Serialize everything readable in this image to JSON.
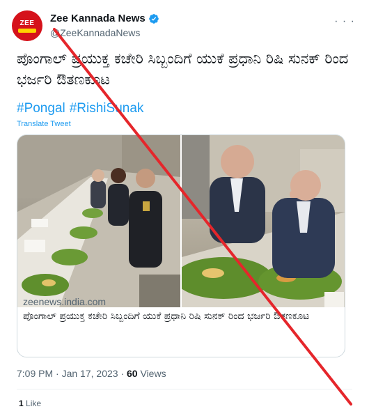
{
  "account": {
    "name": "Zee Kannada News",
    "handle": "@ZeeKannadaNews",
    "avatar_text": "ZEE",
    "verified": true
  },
  "tweet": {
    "text": "ಪೊಂಗಾಲ್ ಪ್ರಯುಕ್ತ ಕಚೇರಿ ಸಿಬ್ಬಂದಿಗೆ ಯುಕೆ ಪ್ರಧಾನಿ ರಿಷಿ ಸುನಕ್ ರಿಂದ ಭರ್ಜರಿ ಔತಣಕೂಟ",
    "hashtags": [
      "#Pongal",
      "#RishiSunak"
    ],
    "translate_label": "Translate Tweet"
  },
  "card": {
    "domain": "zeenews.india.com",
    "title": "ಪೊಂಗಾಲ್ ಪ್ರಯುಕ್ತ ಕಚೇರಿ ಸಿಬ್ಬಂದಿಗೆ ಯುಕೆ ಪ್ರಧಾನಿ ರಿಷಿ ಸುನಕ್ ರಿಂದ ಭರ್ಜರಿ ಔತಣಕೂಟ"
  },
  "meta": {
    "time": "7:09 PM",
    "date": "Jan 17, 2023",
    "separator": "·",
    "views_count": "60",
    "views_label": "Views"
  },
  "engagement": {
    "likes_count": "1",
    "likes_label": "Like"
  },
  "icons": {
    "more": "more-options-icon",
    "verified": "verified-badge-icon"
  },
  "colors": {
    "accent": "#1d9bf0",
    "secondary_text": "#536471",
    "brand_red": "#d5121b",
    "cross": "#e5262b",
    "leaf": "#6e9a3a"
  }
}
